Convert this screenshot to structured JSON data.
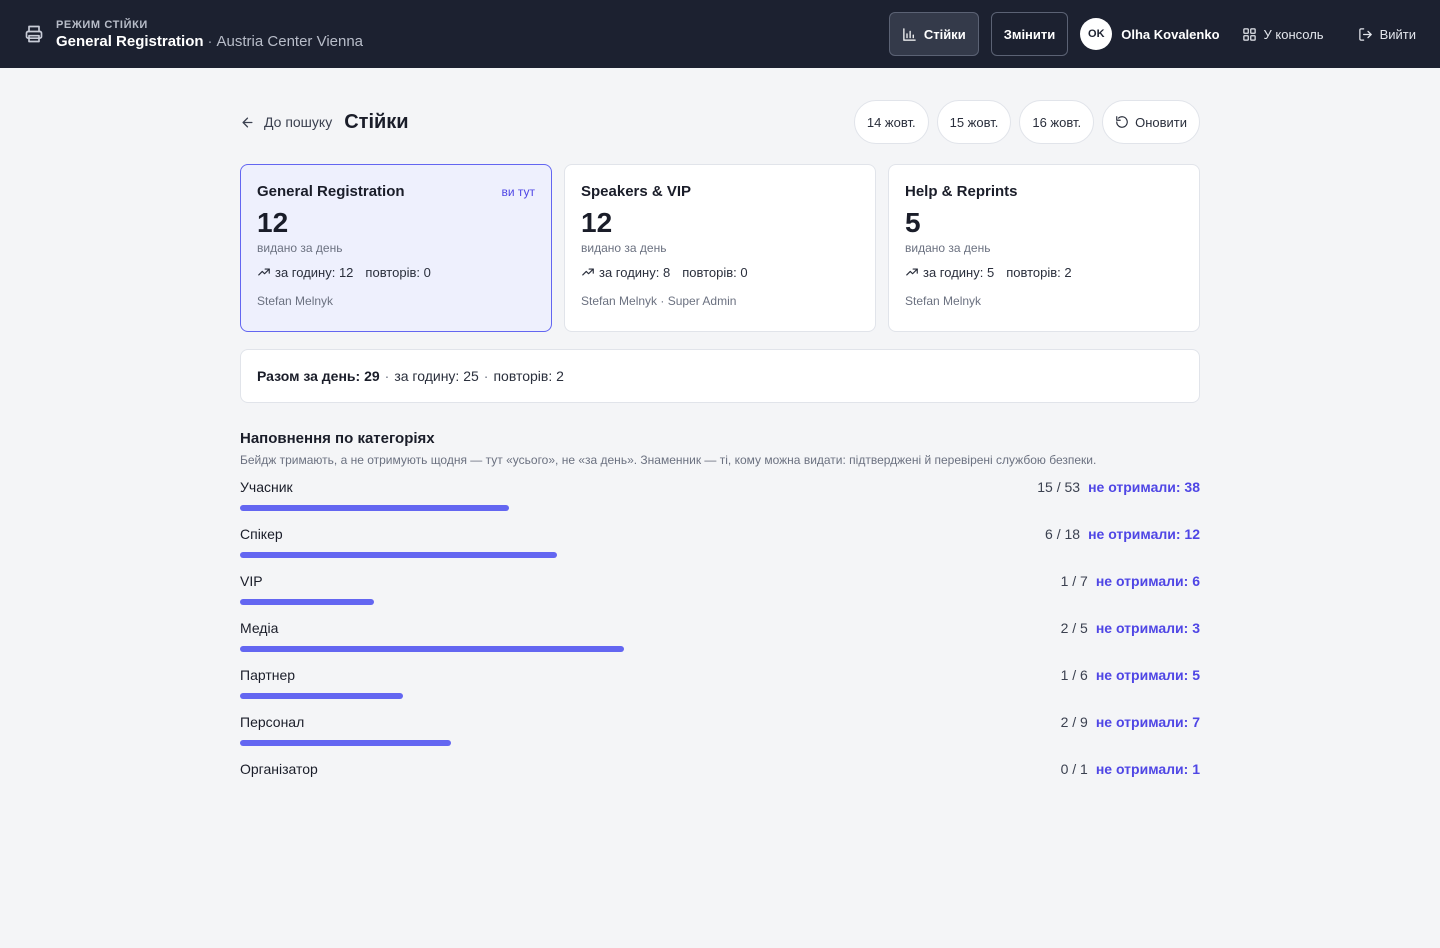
{
  "header": {
    "mode_label": "РЕЖИМ СТІЙКИ",
    "station": "General Registration",
    "separator": "·",
    "venue": "Austria Center Vienna",
    "stands_button": "Стійки",
    "change_button": "Змінити",
    "user_initials": "OK",
    "user_name": "Olha Kovalenko",
    "console_link": "У консоль",
    "logout_link": "Вийти"
  },
  "page": {
    "back_label": "До пошуку",
    "title": "Стійки",
    "days": [
      "14 жовт.",
      "15 жовт.",
      "16 жовт."
    ],
    "refresh_label": "Оновити"
  },
  "stations": [
    {
      "name": "General Registration",
      "here_label": "ви тут",
      "count": "12",
      "count_label": "видано за день",
      "per_hour": "за годину: 12",
      "reprints": "повторів: 0",
      "staff": "Stefan Melnyk"
    },
    {
      "name": "Speakers & VIP",
      "here_label": "",
      "count": "12",
      "count_label": "видано за день",
      "per_hour": "за годину: 8",
      "reprints": "повторів: 0",
      "staff": "Stefan Melnyk · Super Admin"
    },
    {
      "name": "Help & Reprints",
      "here_label": "",
      "count": "5",
      "count_label": "видано за день",
      "per_hour": "за годину: 5",
      "reprints": "повторів: 2",
      "staff": "Stefan Melnyk"
    }
  ],
  "totals": {
    "label": "Разом за день:",
    "value": "29",
    "per_hour": "за годину: 25",
    "reprints": "повторів: 2",
    "separator": "·"
  },
  "categories_section": {
    "title": "Наповнення по категоріях",
    "description": "Бейдж тримають, а не отримують щодня — тут «усього», не «за день». Знаменник — ті, кому можна видати: підтверджені й перевірені службою безпеки.",
    "items": [
      {
        "name": "Учасник",
        "fraction": "15 / 53",
        "missing": "не отримали: 38",
        "fill": 0.28
      },
      {
        "name": "Спікер",
        "fraction": "6 / 18",
        "missing": "не отримали: 12",
        "fill": 0.33
      },
      {
        "name": "VIP",
        "fraction": "1 / 7",
        "missing": "не отримали: 6",
        "fill": 0.14
      },
      {
        "name": "Медіа",
        "fraction": "2 / 5",
        "missing": "не отримали: 3",
        "fill": 0.4
      },
      {
        "name": "Партнер",
        "fraction": "1 / 6",
        "missing": "не отримали: 5",
        "fill": 0.17
      },
      {
        "name": "Персонал",
        "fraction": "2 / 9",
        "missing": "не отримали: 7",
        "fill": 0.22
      },
      {
        "name": "Організатор",
        "fraction": "0 / 1",
        "missing": "не отримали: 1",
        "fill": 0
      }
    ]
  },
  "colors": {
    "accent": "#6366f1",
    "accent_text": "#4f46e5",
    "header_bg": "#1c2130"
  }
}
